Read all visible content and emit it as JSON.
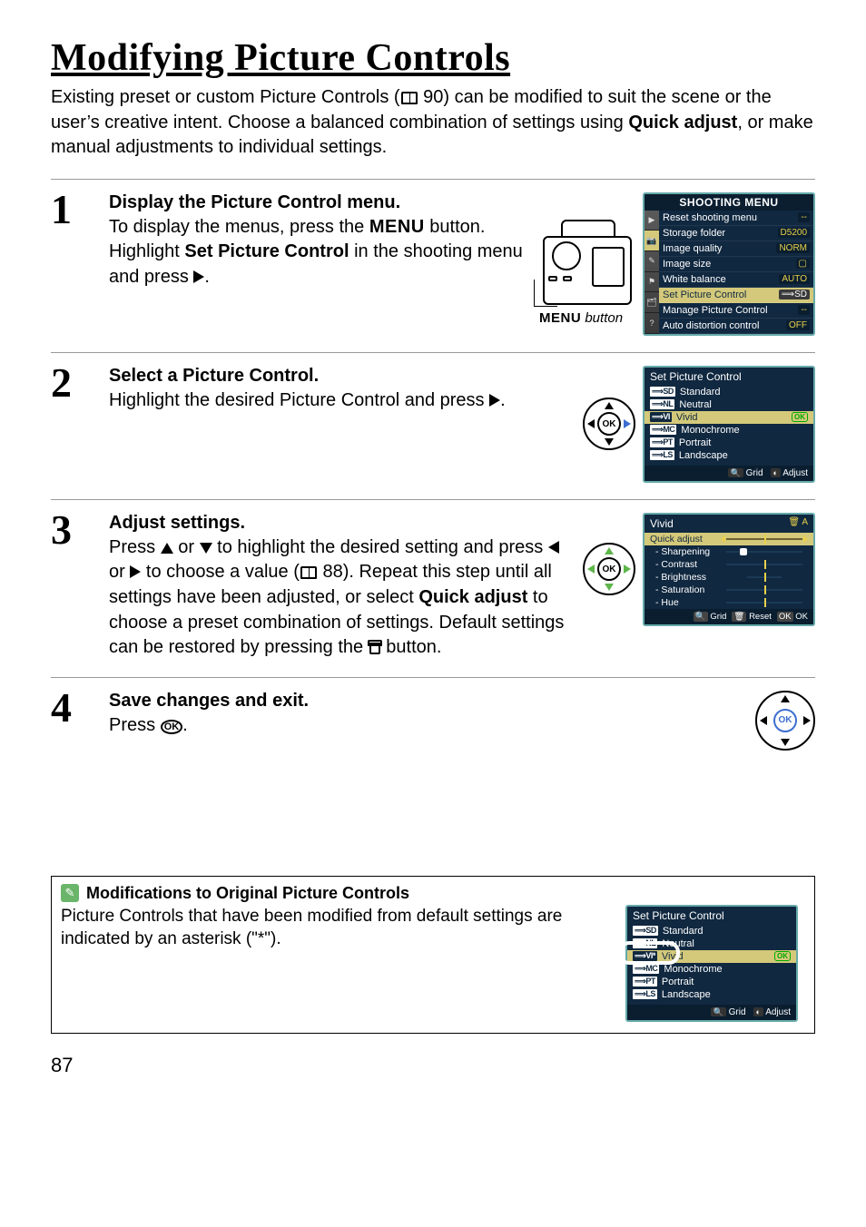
{
  "page_number": "87",
  "title": "Modifying Picture Controls",
  "intro": {
    "t1": "Existing preset or custom Picture Controls (",
    "ref1": "90",
    "t2": ") can be modified to suit the scene or the user’s creative intent.  Choose a balanced combination of settings using ",
    "quick": "Quick adjust",
    "t3": ", or make manual adjustments to individual settings."
  },
  "steps": {
    "s1": {
      "num": "1",
      "title": "Display the Picture Control menu.",
      "t1": "To display the menus, press the ",
      "menu": "MENU",
      "t2": " button. Highlight ",
      "bold": "Set Picture Control",
      "t3": " in the shooting menu and press ",
      "t4": ".",
      "caption_label": "MENU",
      "caption_word": " button"
    },
    "s2": {
      "num": "2",
      "title": "Select a Picture Control.",
      "text1": "Highlight the desired Picture Control and press ",
      "text2": "."
    },
    "s3": {
      "num": "3",
      "title": "Adjust settings.",
      "t1": "Press ",
      "t2": " or ",
      "t3": " to highlight the desired setting and press ",
      "t4": " or ",
      "t5": " to choose a value (",
      "ref": "88",
      "t6": "). Repeat this step until all settings have been adjusted, or select ",
      "bold": "Quick adjust",
      "t7": " to choose a preset combination of settings.  Default settings can be restored by pressing the ",
      "t8": " button."
    },
    "s4": {
      "num": "4",
      "title": "Save changes and exit.",
      "t1": "Press ",
      "t2": "."
    }
  },
  "shooting_menu": {
    "title": "SHOOTING MENU",
    "rows": [
      {
        "label": "Reset shooting menu",
        "val": "--"
      },
      {
        "label": "Storage folder",
        "val": "D5200"
      },
      {
        "label": "Image quality",
        "val": "NORM"
      },
      {
        "label": "Image size",
        "val": "▢"
      },
      {
        "label": "White balance",
        "val": "AUTO"
      },
      {
        "label": "Set Picture Control",
        "val": "⟹SD",
        "selected": true
      },
      {
        "label": "Manage Picture Control",
        "val": "--"
      },
      {
        "label": "Auto distortion control",
        "val": "OFF"
      }
    ]
  },
  "spc_menu": {
    "title": "Set Picture Control",
    "items": [
      {
        "pfx": "⟹SD",
        "label": "Standard"
      },
      {
        "pfx": "⟹NL",
        "label": "Neutral"
      },
      {
        "pfx": "⟹VI",
        "label": "Vivid",
        "selected": true,
        "ok": true
      },
      {
        "pfx": "⟹MC",
        "label": "Monochrome"
      },
      {
        "pfx": "⟹PT",
        "label": "Portrait"
      },
      {
        "pfx": "⟹LS",
        "label": "Landscape"
      }
    ],
    "foot_grid": "Grid",
    "foot_adjust": "Adjust"
  },
  "adjust_menu": {
    "title": "Vivid",
    "items": [
      {
        "name": "Quick adjust",
        "selected": true
      },
      {
        "name": "Sharpening"
      },
      {
        "name": "Contrast"
      },
      {
        "name": "Brightness"
      },
      {
        "name": "Saturation"
      },
      {
        "name": "Hue"
      }
    ],
    "foot_grid": "Grid",
    "foot_reset": "Reset",
    "foot_ok": "OK"
  },
  "note": {
    "title": "Modifications to Original Picture Controls",
    "text": "Picture Controls that have been modified from default settings are indicated by an asterisk (\"*\").",
    "menu": {
      "title": "Set Picture Control",
      "items": [
        {
          "pfx": "⟹SD",
          "label": "Standard"
        },
        {
          "pfx": "⟹NL",
          "label": "Neutral"
        },
        {
          "pfx": "⟹VI*",
          "label": "Vivid",
          "selected": true,
          "ok": true
        },
        {
          "pfx": "⟹MC",
          "label": "Monochrome"
        },
        {
          "pfx": "⟹PT",
          "label": "Portrait"
        },
        {
          "pfx": "⟹LS",
          "label": "Landscape"
        }
      ],
      "foot_grid": "Grid",
      "foot_adjust": "Adjust"
    }
  }
}
